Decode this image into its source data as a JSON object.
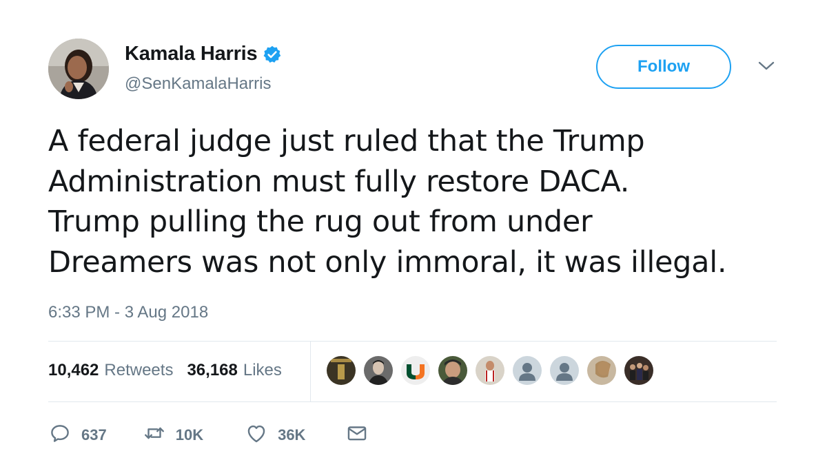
{
  "author": {
    "name": "Kamala Harris",
    "handle": "@SenKamalaHarris",
    "verified_icon": "verified-badge-icon"
  },
  "follow_button": {
    "label": "Follow"
  },
  "tweet": {
    "lines": [
      "A federal judge just ruled that the Trump",
      "Administration must fully restore DACA.",
      "Trump pulling the rug out from under",
      "Dreamers was not only immoral, it was illegal."
    ],
    "timestamp": "6:33 PM - 3 Aug 2018"
  },
  "stats": {
    "retweets_count": "10,462",
    "retweets_label": "Retweets",
    "likes_count": "36,168",
    "likes_label": "Likes"
  },
  "actions": {
    "reply_count": "637",
    "retweet_count": "10K",
    "like_count": "36K"
  },
  "colors": {
    "accent": "#1da1f2",
    "secondary_text": "#657786",
    "primary_text": "#14171a",
    "divider": "#e1e8ed"
  }
}
